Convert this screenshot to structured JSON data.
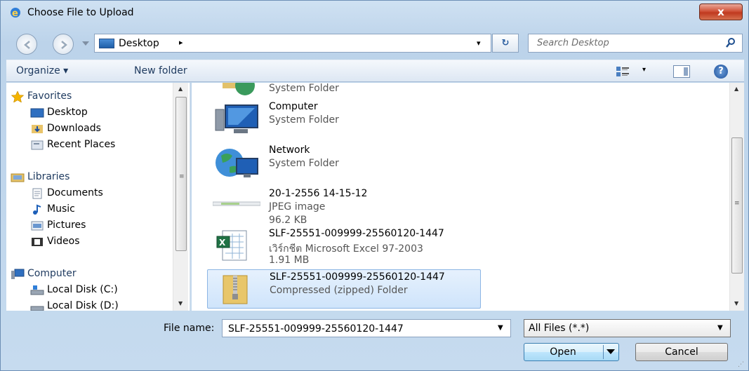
{
  "window": {
    "title": "Choose File to Upload",
    "close_label": "x"
  },
  "address": {
    "location": "Desktop",
    "chevron": "▸",
    "dropdown": "▾",
    "refresh": "↻"
  },
  "search": {
    "placeholder": "Search Desktop"
  },
  "toolbar": {
    "organize": "Organize ▾",
    "new_folder": "New folder",
    "views_dropdown": "▾",
    "help": "?"
  },
  "nav": {
    "favorites": "Favorites",
    "desktop": "Desktop",
    "downloads": "Downloads",
    "recent": "Recent Places",
    "libraries": "Libraries",
    "documents": "Documents",
    "music": "Music",
    "pictures": "Pictures",
    "videos": "Videos",
    "computer": "Computer",
    "disk_c": "Local Disk (C:)",
    "disk_d": "Local Disk (D:)"
  },
  "files": {
    "partial": {
      "type": "System Folder"
    },
    "computer": {
      "name": "Computer",
      "type": "System Folder"
    },
    "network": {
      "name": "Network",
      "type": "System Folder"
    },
    "jpeg": {
      "name": "20-1-2556 14-15-12",
      "type": "JPEG image",
      "size": "96.2 KB"
    },
    "excel": {
      "name": "SLF-25551-009999-25560120-1447",
      "type": "เวิร์กชีต Microsoft Excel 97-2003",
      "size": "1.91 MB"
    },
    "zip": {
      "name": "SLF-25551-009999-25560120-1447",
      "type": "Compressed (zipped) Folder"
    }
  },
  "bottom": {
    "file_name_label": "File name:",
    "file_name_value": "SLF-25551-009999-25560120-1447",
    "filter": "All Files (*.*)",
    "open": "Open",
    "cancel": "Cancel"
  },
  "colors": {
    "accent": "#3c7fb1",
    "selection": "#cfe4fb",
    "close": "#c0391f"
  }
}
